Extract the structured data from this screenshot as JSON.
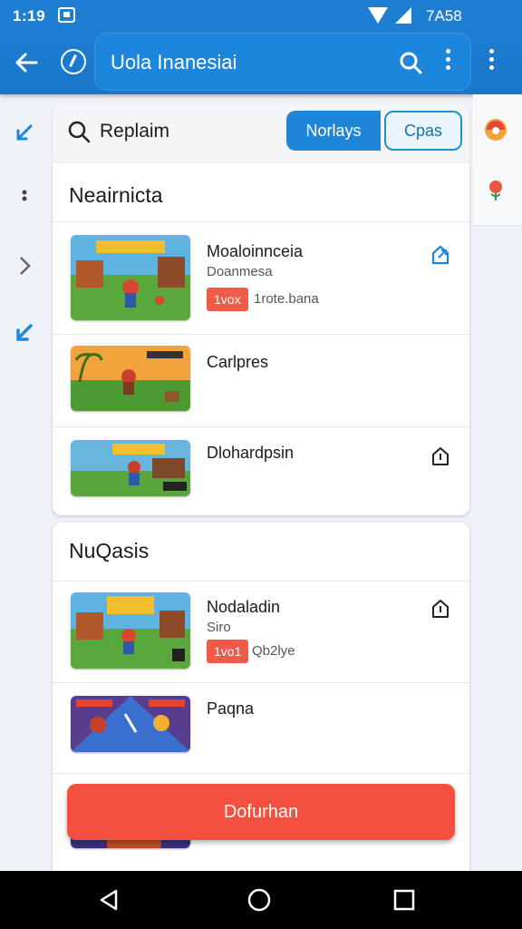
{
  "status": {
    "time": "1:19",
    "battery": "7A58"
  },
  "appbar": {
    "title": "Uola Inanesiai"
  },
  "search": {
    "query": "Replaim",
    "filter_active": "Norlays",
    "filter_other": "Cpas"
  },
  "sections": [
    {
      "title": "Neairnicta",
      "items": [
        {
          "title": "Moaloinnceia",
          "subtitle": "Doanmesa",
          "badge": "1vox",
          "meta": "1rote.bana"
        },
        {
          "title": "Carlpres"
        },
        {
          "title": "Dlohardpsin"
        }
      ]
    },
    {
      "title": "NuQasis",
      "items": [
        {
          "title": "Nodaladin",
          "subtitle": "Siro",
          "badge": "1vo1",
          "meta": "Qb2lye"
        },
        {
          "title": "Paqna"
        }
      ]
    }
  ],
  "cta": {
    "label": "Dofurhan"
  },
  "colors": {
    "primary": "#1e7fd2",
    "accent": "#f4503f",
    "badge": "#f05a48"
  },
  "icons": [
    "back-arrow-icon",
    "speed-icon",
    "search-icon",
    "more-vert-icon",
    "collapse-icon",
    "chevron-right-icon",
    "download-icon",
    "home-share-icon",
    "save-icon",
    "back-nav-icon",
    "home-nav-icon",
    "recents-nav-icon"
  ]
}
